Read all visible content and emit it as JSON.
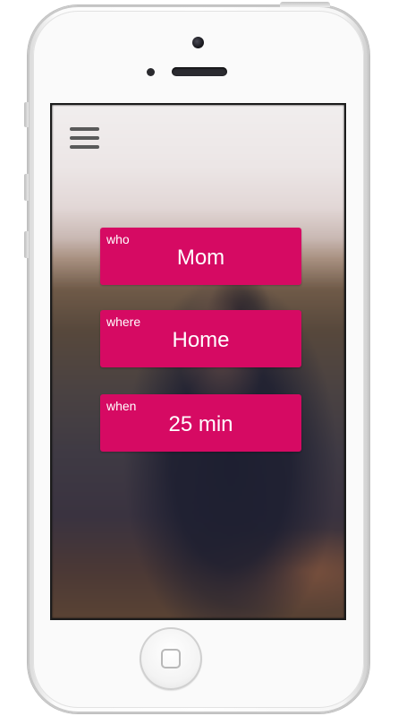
{
  "menu": {
    "icon": "hamburger-icon"
  },
  "cards": [
    {
      "tag": "who",
      "value": "Mom"
    },
    {
      "tag": "where",
      "value": "Home"
    },
    {
      "tag": "when",
      "value": "25 min"
    }
  ],
  "colors": {
    "card_background": "#d60a63",
    "card_text": "#ffffff",
    "menu_icon": "#5a5a5a"
  }
}
